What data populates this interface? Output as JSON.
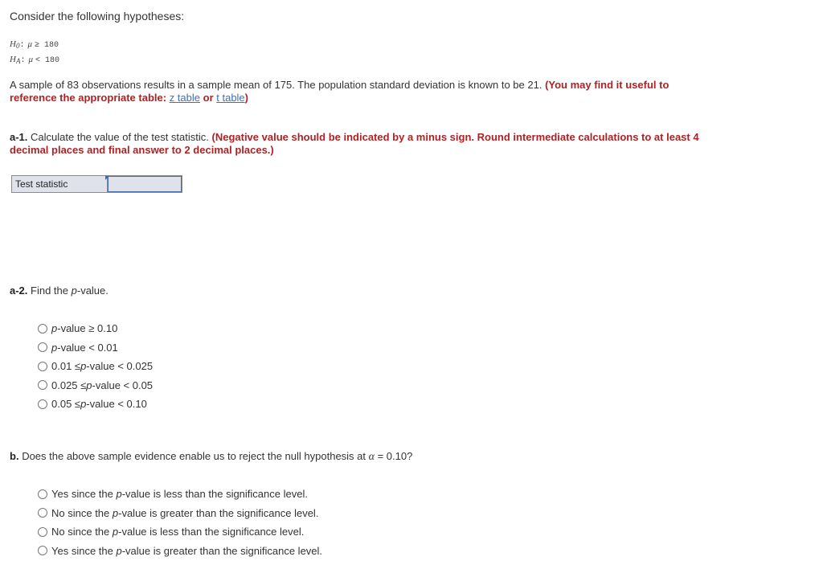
{
  "intro": "Consider the following hypotheses:",
  "hypotheses": {
    "h0": {
      "var": "H",
      "sub": "0",
      "symbol": "μ",
      "op": "≥",
      "value": "180"
    },
    "ha": {
      "var": "H",
      "sub": "A",
      "symbol": "μ",
      "op": "<",
      "value": "180"
    }
  },
  "problem": {
    "text": "A sample of 83 observations results in a sample mean of 175. The population standard deviation is known to be 21.",
    "note_start": "(You may find it useful to reference the appropriate table:",
    "link_z": "z table",
    "or": "or",
    "link_t": "t table",
    "note_end": ")"
  },
  "a1": {
    "label": "a-1.",
    "question": "Calculate the value of the test statistic.",
    "instruction": "(Negative value should be indicated by a minus sign. Round intermediate calculations to at least 4 decimal places and final answer to 2 decimal places.)",
    "table_label": "Test statistic",
    "input_value": ""
  },
  "a2": {
    "label": "a-2.",
    "question_pre": "Find the ",
    "question_p": "p",
    "question_post": "-value.",
    "options": [
      {
        "pre": "",
        "p": "p",
        "post": "-value ≥ 0.10"
      },
      {
        "pre": "",
        "p": "p",
        "post": "-value < 0.01"
      },
      {
        "pre": "0.01 ≤ ",
        "p": "p",
        "post": "-value < 0.025"
      },
      {
        "pre": "0.025 ≤ ",
        "p": "p",
        "post": "-value < 0.05"
      },
      {
        "pre": "0.05 ≤ ",
        "p": "p",
        "post": "-value < 0.10"
      }
    ]
  },
  "b": {
    "label": "b.",
    "question_pre": "Does the above sample evidence enable us to reject the null hypothesis at ",
    "alpha": "α",
    "question_post": " = 0.10?",
    "options": [
      {
        "pre": "Yes since the ",
        "p": "p",
        "post": "-value is less than the significance level."
      },
      {
        "pre": "No since the ",
        "p": "p",
        "post": "-value is greater than the significance level."
      },
      {
        "pre": "No since the ",
        "p": "p",
        "post": "-value is less than the significance level."
      },
      {
        "pre": "Yes since the ",
        "p": "p",
        "post": "-value is greater than the significance level."
      }
    ]
  },
  "colors": {
    "instruction_red": "#ae2224",
    "link_blue": "#3d6fbb",
    "input_bg": "#dfe2ea"
  }
}
